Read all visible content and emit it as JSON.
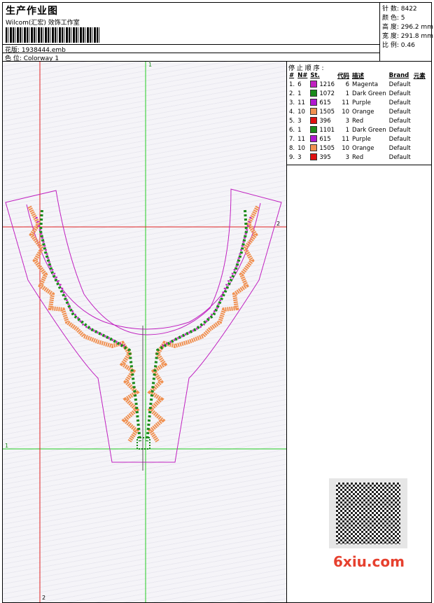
{
  "header": {
    "title": "生产作业图",
    "company": "Wilcom(汇宏) 效饰工作室",
    "design_label": "花版: 1938444.emb",
    "colorway_label": "色 位: Colorway 1",
    "stats": [
      "针 数: 8422",
      "颜 色: 5",
      "高 度: 296.2 mm",
      "宽 度: 291.8 mm",
      "比 例: 0.46"
    ]
  },
  "sequence": {
    "title": "停 止 顺 序 :",
    "columns": [
      "#",
      "N#",
      "St.",
      "代码",
      "描述",
      "Brand",
      "元素"
    ],
    "rows": [
      {
        "no": "1.",
        "n": "6",
        "color": "#c020c0",
        "st": "1216",
        "code": "6",
        "desc": "Magenta",
        "brand": "Default"
      },
      {
        "no": "2.",
        "n": "1",
        "color": "#1a8a1a",
        "st": "1072",
        "code": "1",
        "desc": "Dark Green",
        "brand": "Default"
      },
      {
        "no": "3.",
        "n": "11",
        "color": "#b018d0",
        "st": "615",
        "code": "11",
        "desc": "Purple",
        "brand": "Default"
      },
      {
        "no": "4.",
        "n": "10",
        "color": "#f09050",
        "st": "1505",
        "code": "10",
        "desc": "Orange",
        "brand": "Default"
      },
      {
        "no": "5.",
        "n": "3",
        "color": "#e01010",
        "st": "396",
        "code": "3",
        "desc": "Red",
        "brand": "Default"
      },
      {
        "no": "6.",
        "n": "1",
        "color": "#1a8a1a",
        "st": "1101",
        "code": "1",
        "desc": "Dark Green",
        "brand": "Default"
      },
      {
        "no": "7.",
        "n": "11",
        "color": "#b018d0",
        "st": "615",
        "code": "11",
        "desc": "Purple",
        "brand": "Default"
      },
      {
        "no": "8.",
        "n": "10",
        "color": "#f09050",
        "st": "1505",
        "code": "10",
        "desc": "Orange",
        "brand": "Default"
      },
      {
        "no": "9.",
        "n": "3",
        "color": "#e01010",
        "st": "395",
        "code": "3",
        "desc": "Red",
        "brand": "Default"
      }
    ]
  },
  "guides": {
    "green_top": "1",
    "green_left": "1",
    "red_right": "2",
    "red_bottom": "2"
  },
  "watermark": "6xiu.com",
  "colors": {
    "outline": "#c020c0",
    "guide_green": "#22cc22",
    "guide_red": "#e02020",
    "stitch_orange": "#f09050",
    "stitch_green": "#1a8a1a"
  }
}
